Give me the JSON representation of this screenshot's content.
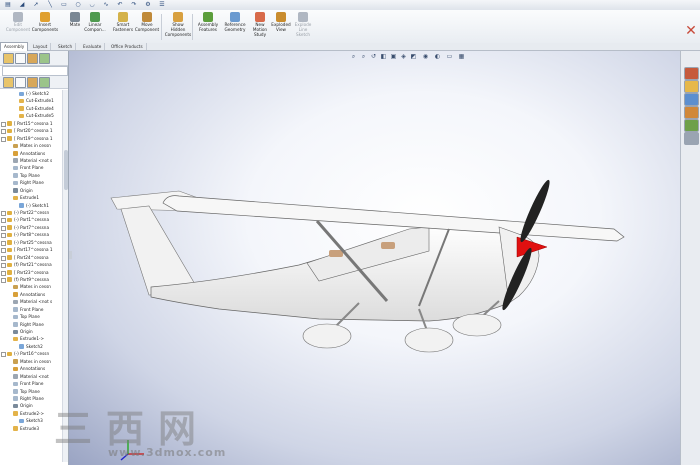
{
  "ribbon": {
    "buttons": [
      {
        "label": "Edit\nComponent",
        "icon": "edit-component-icon",
        "color": "#b0b7c2",
        "enabled": false
      },
      {
        "label": "Insert\nComponents",
        "icon": "insert-components-icon",
        "color": "#e0a030",
        "enabled": true
      },
      {
        "label": "Mate",
        "icon": "mate-icon",
        "color": "#7a8794",
        "enabled": true
      },
      {
        "label": "Linear\nCompon...",
        "icon": "linear-pattern-icon",
        "color": "#4f9a4f",
        "enabled": true
      },
      {
        "label": "Smart\nFasteners",
        "icon": "smart-fasteners-icon",
        "color": "#d4b24a",
        "enabled": true
      },
      {
        "label": "Move\nComponent",
        "icon": "move-component-icon",
        "color": "#c08a3a",
        "enabled": true
      },
      {
        "label": "Show\nHidden\nComponents",
        "icon": "show-hidden-icon",
        "color": "#d8a040",
        "enabled": true
      },
      {
        "label": "Assembly\nFeatures",
        "icon": "assembly-features-icon",
        "color": "#5c9e3c",
        "enabled": true
      },
      {
        "label": "Reference\nGeometry",
        "icon": "reference-geometry-icon",
        "color": "#6a9ad0",
        "enabled": true
      },
      {
        "label": "New\nMotion\nStudy",
        "icon": "new-motion-study-icon",
        "color": "#d86a4a",
        "enabled": true
      },
      {
        "label": "Exploded\nView",
        "icon": "exploded-view-icon",
        "color": "#c98c2e",
        "enabled": true
      },
      {
        "label": "Explode\nLine\nSketch",
        "icon": "explode-line-sketch-icon",
        "color": "#b0b7c2",
        "enabled": false
      }
    ]
  },
  "tabs": [
    "Assembly",
    "Layout",
    "Sketch",
    "Evaluate",
    "Office Products"
  ],
  "tree": [
    {
      "depth": 2,
      "text": "(-) Sketch2",
      "icon": "sketch"
    },
    {
      "depth": 2,
      "text": "Cut-Extrude1",
      "icon": "feature"
    },
    {
      "depth": 2,
      "text": "Cut-Extrude4",
      "icon": "feature"
    },
    {
      "depth": 2,
      "text": "Cut-Extrude5",
      "icon": "feature"
    },
    {
      "depth": 0,
      "text": "[ Part15^cessna 1",
      "icon": "part"
    },
    {
      "depth": 0,
      "text": "[ Part20^cessna 1",
      "icon": "part"
    },
    {
      "depth": 0,
      "text": "[ Part19^cessna 1",
      "icon": "part"
    },
    {
      "depth": 1,
      "text": "Mates in cessn",
      "icon": "mates"
    },
    {
      "depth": 1,
      "text": "Annotations",
      "icon": "annot"
    },
    {
      "depth": 1,
      "text": "Material <not s",
      "icon": "material"
    },
    {
      "depth": 1,
      "text": "Front Plane",
      "icon": "plane"
    },
    {
      "depth": 1,
      "text": "Top Plane",
      "icon": "plane"
    },
    {
      "depth": 1,
      "text": "Right Plane",
      "icon": "plane"
    },
    {
      "depth": 1,
      "text": "Origin",
      "icon": "origin"
    },
    {
      "depth": 1,
      "text": "Extrude1",
      "icon": "feature"
    },
    {
      "depth": 2,
      "text": "(-) Sketch1",
      "icon": "sketch"
    },
    {
      "depth": 0,
      "text": "(-) Part22^cessn",
      "icon": "part"
    },
    {
      "depth": 0,
      "text": "(-) Part1^cessna",
      "icon": "part"
    },
    {
      "depth": 0,
      "text": "(-) Part7^cessna",
      "icon": "part"
    },
    {
      "depth": 0,
      "text": "(-) Part8^cessna",
      "icon": "part"
    },
    {
      "depth": 0,
      "text": "(-) Part25^cessna",
      "icon": "part"
    },
    {
      "depth": 0,
      "text": "[ Part17^cessna 1",
      "icon": "part"
    },
    {
      "depth": 0,
      "text": "[ Part24^cessna",
      "icon": "part"
    },
    {
      "depth": 0,
      "text": "(f) Part21^cessna",
      "icon": "part"
    },
    {
      "depth": 0,
      "text": "[ Part23^cessna",
      "icon": "part"
    },
    {
      "depth": 0,
      "text": "(f) Part9^cessna",
      "icon": "part"
    },
    {
      "depth": 1,
      "text": "Mates in cessn",
      "icon": "mates"
    },
    {
      "depth": 1,
      "text": "Annotations",
      "icon": "annot"
    },
    {
      "depth": 1,
      "text": "Material <not s",
      "icon": "material"
    },
    {
      "depth": 1,
      "text": "Front Plane",
      "icon": "plane"
    },
    {
      "depth": 1,
      "text": "Top Plane",
      "icon": "plane"
    },
    {
      "depth": 1,
      "text": "Right Plane",
      "icon": "plane"
    },
    {
      "depth": 1,
      "text": "Origin",
      "icon": "origin"
    },
    {
      "depth": 1,
      "text": "Extrude1->",
      "icon": "feature"
    },
    {
      "depth": 2,
      "text": "Sketch2",
      "icon": "sketch"
    },
    {
      "depth": 0,
      "text": "(-) Part16^cessn",
      "icon": "part"
    },
    {
      "depth": 1,
      "text": "Mates in cessn",
      "icon": "mates"
    },
    {
      "depth": 1,
      "text": "Annotations",
      "icon": "annot"
    },
    {
      "depth": 1,
      "text": "Material <not",
      "icon": "material"
    },
    {
      "depth": 1,
      "text": "Front Plane",
      "icon": "plane"
    },
    {
      "depth": 1,
      "text": "Top Plane",
      "icon": "plane"
    },
    {
      "depth": 1,
      "text": "Right Plane",
      "icon": "plane"
    },
    {
      "depth": 1,
      "text": "Origin",
      "icon": "origin"
    },
    {
      "depth": 1,
      "text": "Extrude2->",
      "icon": "feature"
    },
    {
      "depth": 2,
      "text": "Sketch3",
      "icon": "sketch"
    },
    {
      "depth": 1,
      "text": "Extrude3",
      "icon": "feature"
    }
  ],
  "watermark": {
    "chars": "三西网",
    "url": "www.3dmox.com"
  },
  "colors": {
    "propeller": "#222222",
    "spinner": "#e01010",
    "seat": "#c8a07c"
  }
}
